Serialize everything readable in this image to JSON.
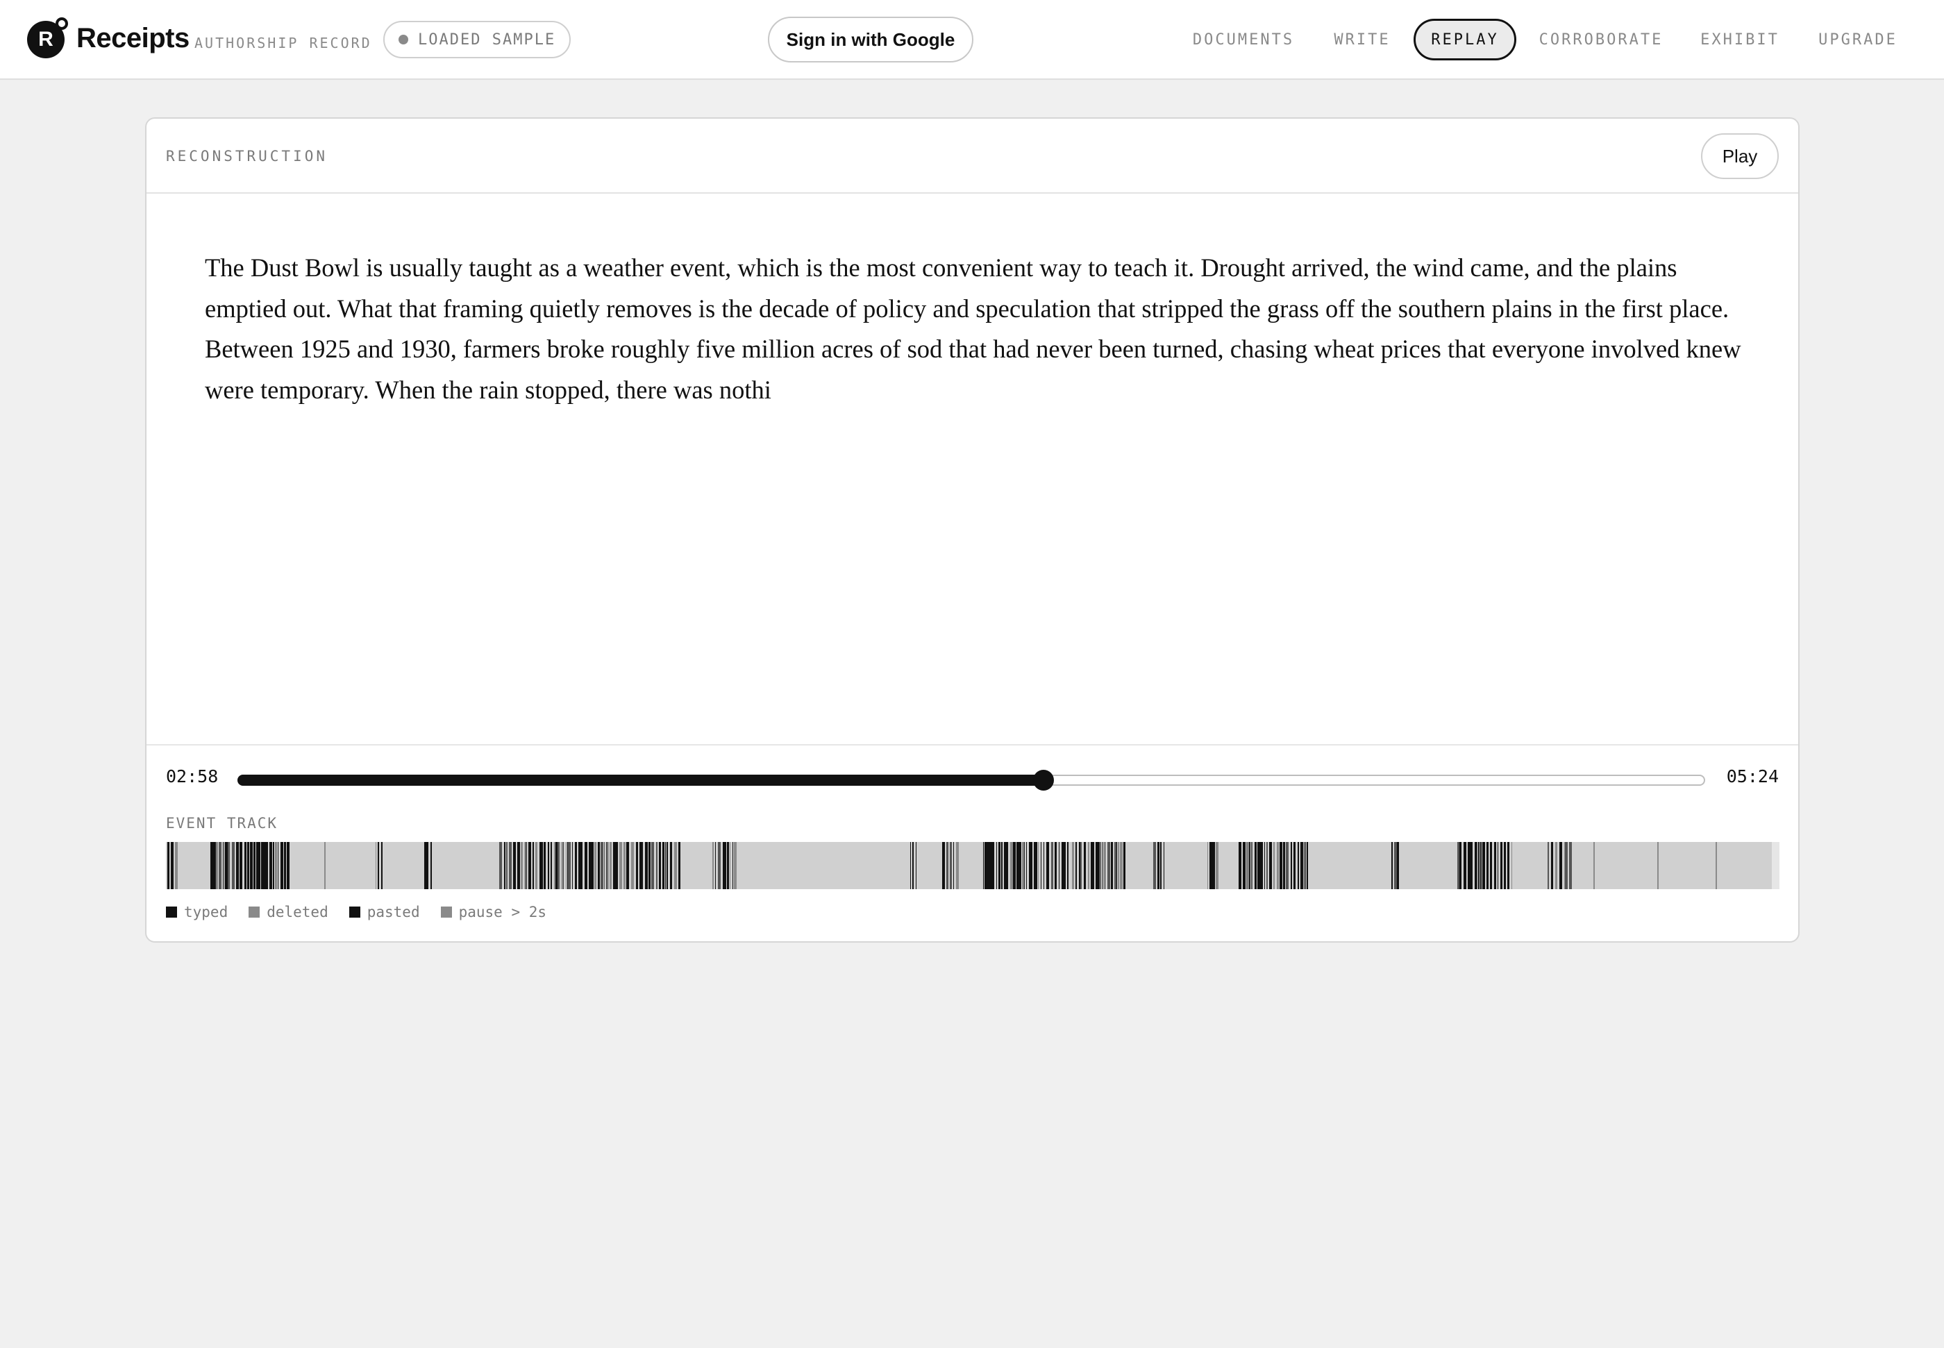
{
  "header": {
    "logo_letter": "R",
    "brand": "Receipts",
    "brand_sub": "AUTHORSHIP RECORD",
    "sample_label": "LOADED SAMPLE",
    "signin_label": "Sign in with Google",
    "nav": [
      {
        "label": "DOCUMENTS",
        "active": false
      },
      {
        "label": "WRITE",
        "active": false
      },
      {
        "label": "REPLAY",
        "active": true
      },
      {
        "label": "CORROBORATE",
        "active": false
      },
      {
        "label": "EXHIBIT",
        "active": false
      },
      {
        "label": "UPGRADE",
        "active": false
      }
    ]
  },
  "reconstruction": {
    "title": "RECONSTRUCTION",
    "play_label": "Play",
    "text": "The Dust Bowl is usually taught as a weather event, which is the most convenient way to teach it. Drought arrived, the wind came, and the plains emptied out. What that framing quietly removes is the decade of policy and speculation that stripped the grass off the southern plains in the first place. Between 1925 and 1930, farmers broke roughly five million acres of sod that had never been turned, chasing wheat prices that everyone involved knew were temporary. When the rain stopped, there was nothi"
  },
  "playback": {
    "current_time": "02:58",
    "total_time": "05:24",
    "progress": 0.549
  },
  "event_track": {
    "label": "EVENT TRACK",
    "colors": {
      "typed": "#111111",
      "deleted": "#8a8a8a",
      "pasted": "#111111",
      "pause": "#8a8a8a",
      "background": "#d0d0d0"
    },
    "legend": [
      {
        "label": "typed",
        "color": "#111111"
      },
      {
        "label": "deleted",
        "color": "#8a8a8a"
      },
      {
        "label": "pasted",
        "color": "#111111"
      },
      {
        "label": "pause > 2s",
        "color": "#8a8a8a"
      }
    ]
  }
}
